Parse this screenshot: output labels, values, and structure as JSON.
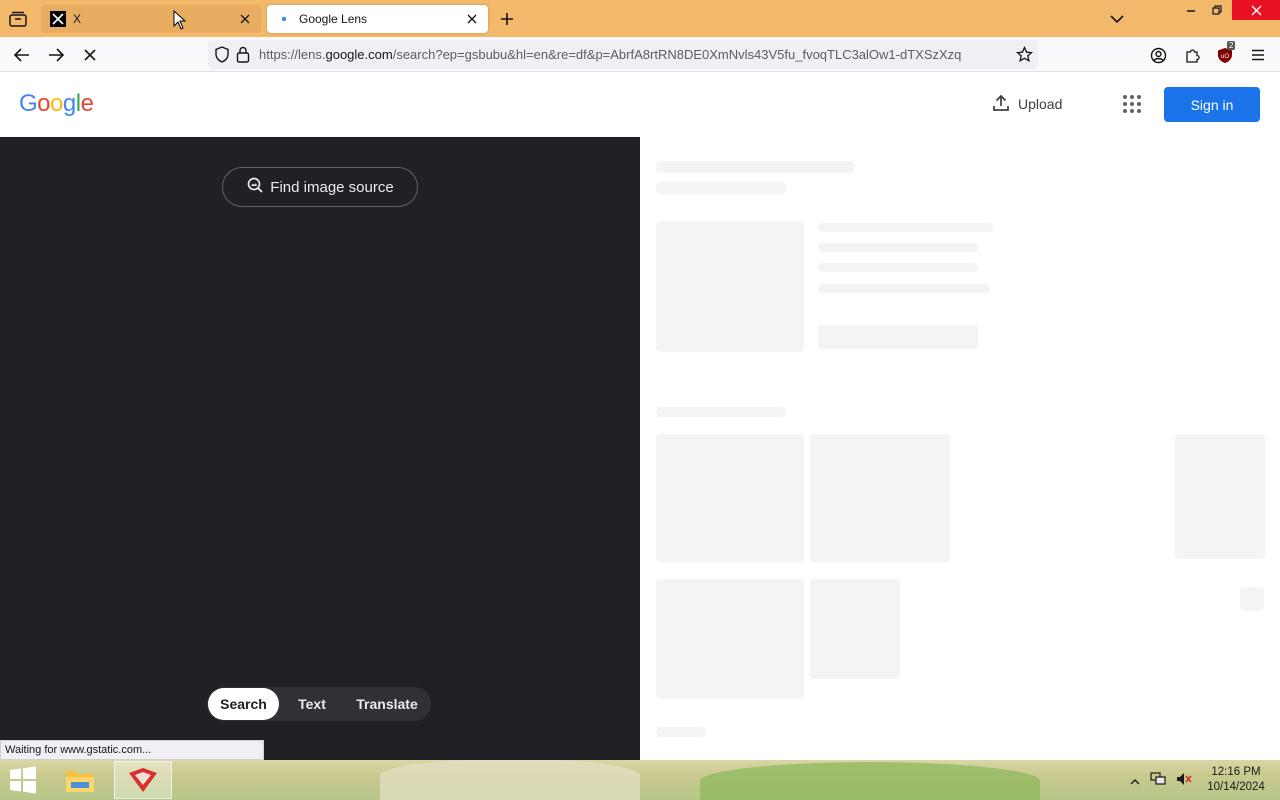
{
  "browser": {
    "tabs": [
      {
        "title": "X",
        "favicon": "x-logo-icon",
        "active": false
      },
      {
        "title": "Google Lens",
        "favicon": "loading-dot-icon",
        "active": true
      }
    ],
    "url": {
      "prefix": "https://lens.",
      "domain": "google.com",
      "rest": "/search?ep=gsbubu&hl=en&re=df&p=AbrfA8rtRN8DE0XmNvls43V5fu_fvoqTLC3alOw1-dTXSzXzq"
    },
    "status_text": "Waiting for www.gstatic.com...",
    "ublock_count": "2",
    "colors": {
      "tabstrip": "#f3b96a",
      "close_button": "#e81123"
    }
  },
  "google": {
    "logo": [
      "G",
      "o",
      "o",
      "g",
      "l",
      "e"
    ],
    "logo_colors": [
      "#4285f4",
      "#ea4335",
      "#fbbc05",
      "#4285f4",
      "#34a853",
      "#ea4335"
    ],
    "upload_label": "Upload",
    "signin_label": "Sign in",
    "accent": "#1a73e8"
  },
  "lens": {
    "find_source_label": "Find image source",
    "modes": [
      {
        "label": "Search",
        "selected": true
      },
      {
        "label": "Text",
        "selected": false
      },
      {
        "label": "Translate",
        "selected": false
      }
    ],
    "panel_color": "#202124"
  },
  "taskbar": {
    "time": "12:16 PM",
    "date": "10/14/2024"
  }
}
